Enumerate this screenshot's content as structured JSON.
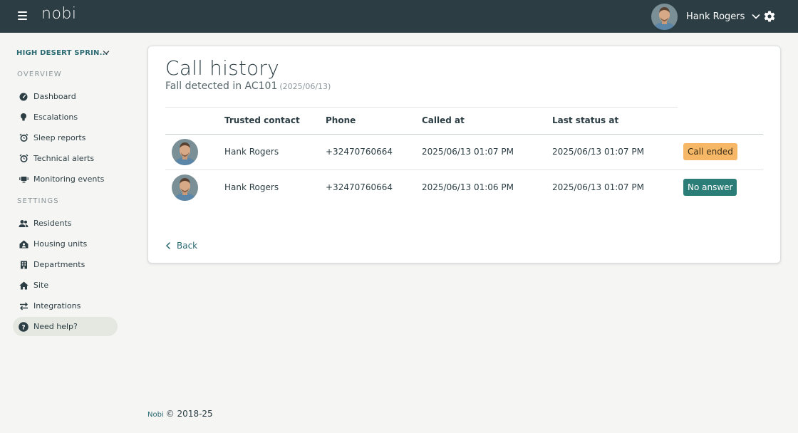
{
  "app": {
    "logo": "nobi"
  },
  "user": {
    "name": "Hank Rogers"
  },
  "sidebar": {
    "site": "HIGH DESERT SPRIN...",
    "overview_label": "OVERVIEW",
    "overview_items": [
      {
        "label": "Dashboard",
        "icon": "gauge-icon"
      },
      {
        "label": "Escalations",
        "icon": "lightbulb-icon"
      },
      {
        "label": "Sleep reports",
        "icon": "alarm-clock-icon"
      },
      {
        "label": "Technical alerts",
        "icon": "alarm-clock-icon"
      },
      {
        "label": "Monitoring events",
        "icon": "monitor-icon"
      }
    ],
    "settings_label": "SETTINGS",
    "settings_items": [
      {
        "label": "Residents",
        "icon": "people-icon"
      },
      {
        "label": "Housing units",
        "icon": "house-person-icon"
      },
      {
        "label": "Departments",
        "icon": "building-icon"
      },
      {
        "label": "Site",
        "icon": "home-icon"
      },
      {
        "label": "Integrations",
        "icon": "swap-arrows-icon"
      }
    ],
    "help_label": "Need help?"
  },
  "main": {
    "title": "Call history",
    "subtitle": "Fall detected in AC101",
    "subtitle_date": "(2025/06/13)",
    "table": {
      "headers": [
        "Trusted contact",
        "Phone",
        "Called at",
        "Last status at"
      ],
      "rows": [
        {
          "contact": "Hank Rogers",
          "phone": "+32470760664",
          "called_at": "2025/06/13 01:07 PM",
          "last_status_at": "2025/06/13 01:07 PM",
          "status": "Call ended",
          "status_color": "#f6b867"
        },
        {
          "contact": "Hank Rogers",
          "phone": "+32470760664",
          "called_at": "2025/06/13 01:06 PM",
          "last_status_at": "2025/06/13 01:07 PM",
          "status": "No answer",
          "status_color": "#2b7d78"
        }
      ]
    },
    "back_label": "Back"
  },
  "footer": {
    "brand": "Nobi",
    "copyright": "© 2018-25"
  },
  "colors": {
    "topbar": "#2c3e44",
    "accent": "#2b6a73",
    "page_bg": "#f5f5f3"
  }
}
